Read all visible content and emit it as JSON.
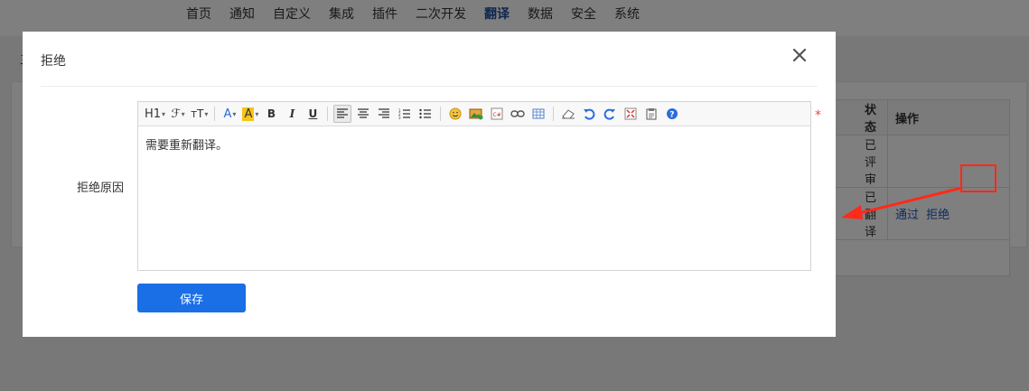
{
  "topnav": {
    "items": [
      "首页",
      "通知",
      "自定义",
      "集成",
      "插件",
      "二次开发",
      "翻译",
      "数据",
      "安全",
      "系统"
    ],
    "active": "翻译"
  },
  "background": {
    "breadcrumb": "三",
    "table": {
      "headers": [
        "状态",
        "操作"
      ],
      "rows": [
        {
          "status": "已评审",
          "actions": []
        },
        {
          "status": "已翻译",
          "actions": [
            "通过",
            "拒绝"
          ]
        }
      ]
    }
  },
  "modal": {
    "title": "拒绝",
    "field_label": "拒绝原因",
    "required_mark": "*",
    "editor": {
      "toolbar": {
        "heading": "H1",
        "font_family": "ℱ",
        "font_size": "тT",
        "font_color": "A",
        "bg_color": "A",
        "bold": "B",
        "italic": "I",
        "underline": "U"
      },
      "content": "需要重新翻译。"
    },
    "save_label": "保存"
  },
  "colors": {
    "accent": "#1a6ee6",
    "highlight": "#ff2a1a",
    "link": "#1a56c4",
    "required": "#e74c3c"
  }
}
